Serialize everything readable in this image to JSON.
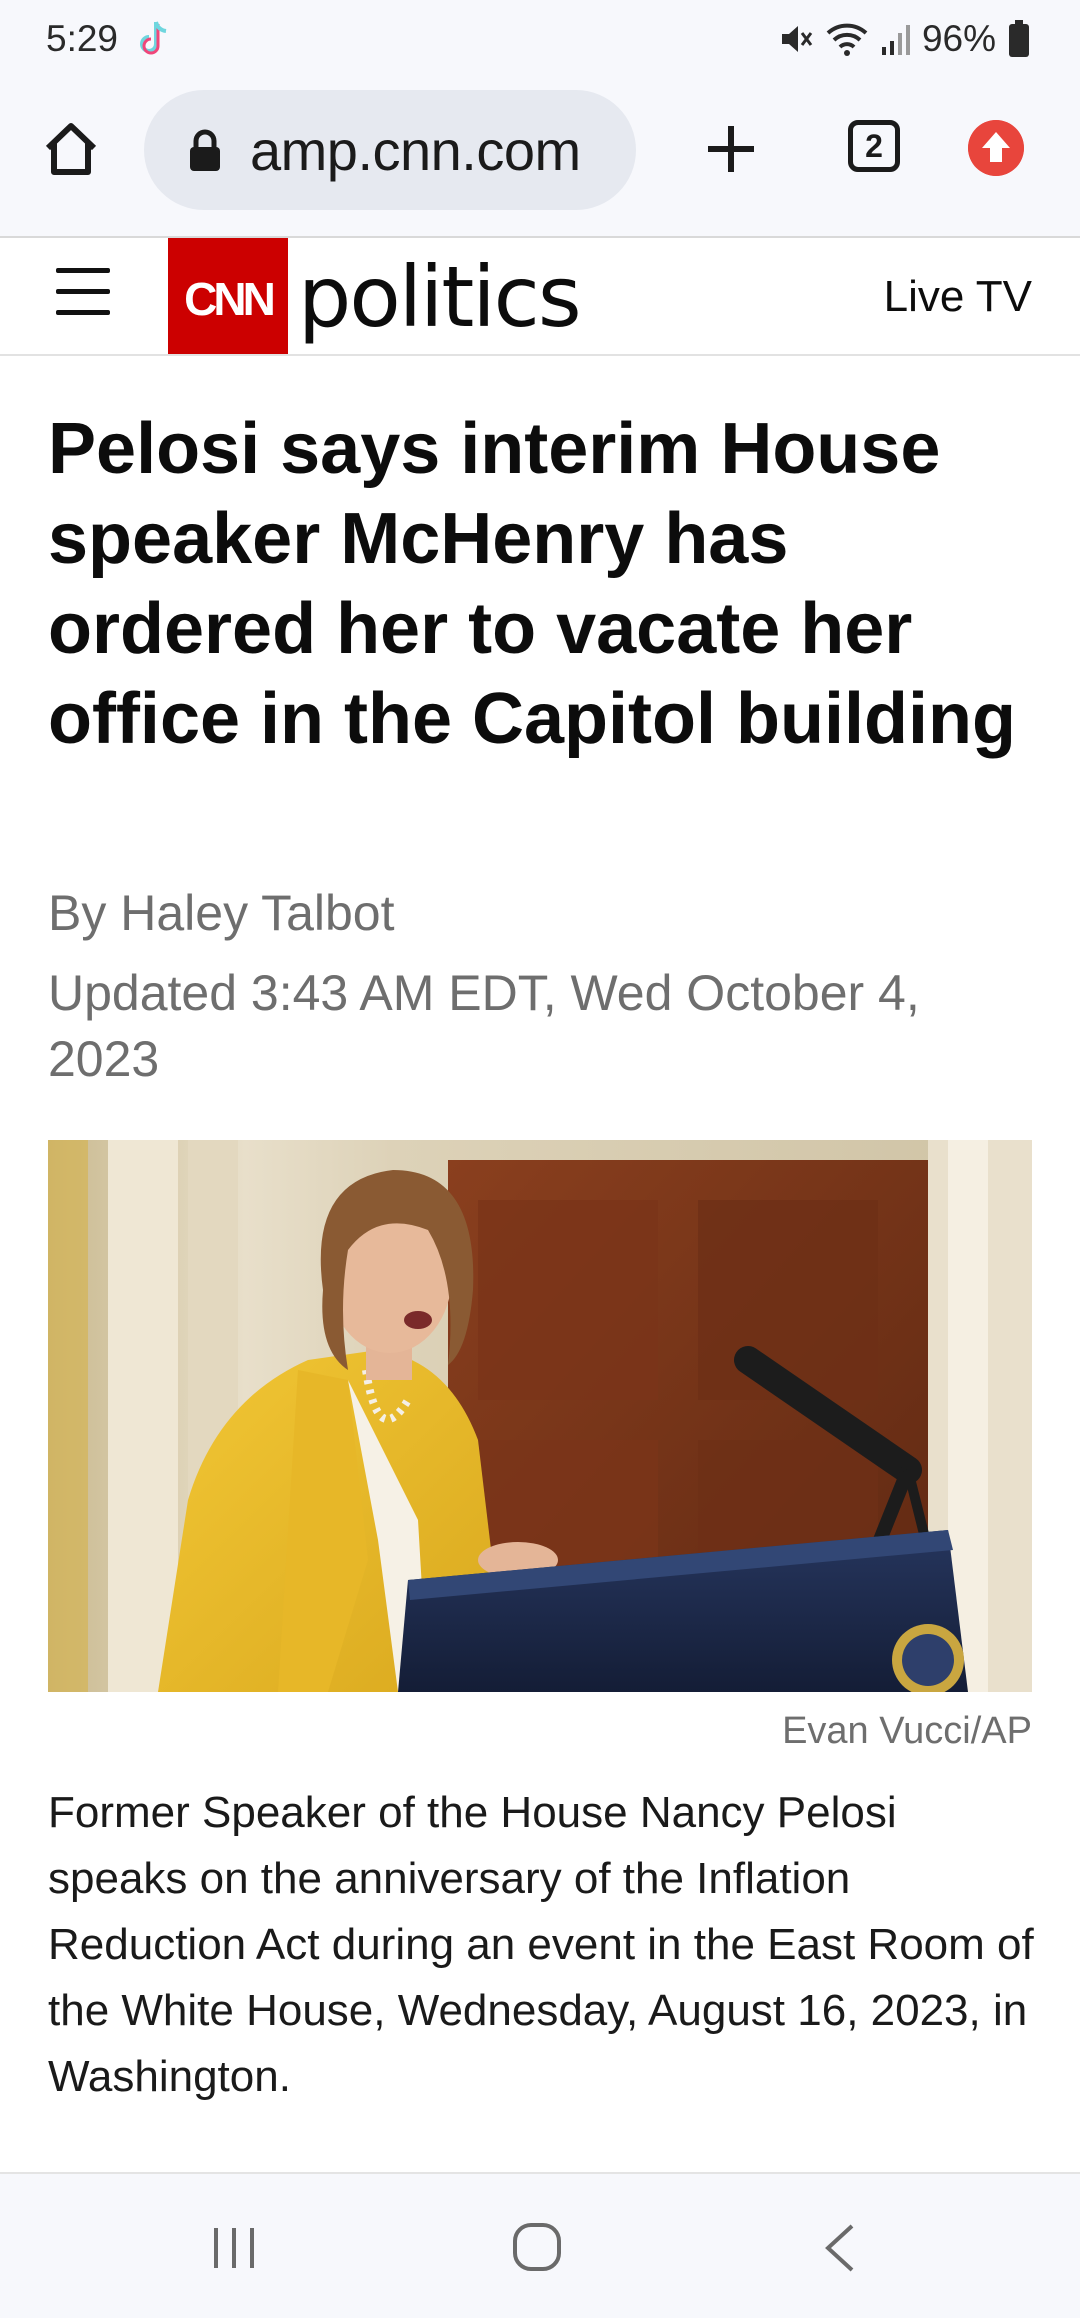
{
  "status_bar": {
    "time": "5:29",
    "battery": "96%",
    "icons": [
      "tiktok-icon",
      "mute-icon",
      "wifi-icon",
      "signal-icon",
      "battery-icon"
    ]
  },
  "browser": {
    "url": "amp.cnn.com",
    "tab_count": "2",
    "icons": [
      "home-icon",
      "lock-icon",
      "plus-icon",
      "tabs-icon",
      "update-icon"
    ]
  },
  "site_header": {
    "logo_text": "CNN",
    "section": "politics",
    "live_tv": "Live TV",
    "brand_color": "#cc0000"
  },
  "article": {
    "headline": "Pelosi says interim House speaker McHenry has ordered her to vacate her office in the Capitol building",
    "byline_prefix": "By ",
    "author": "Haley Talbot",
    "updated": "Updated 3:43 AM EDT, Wed October 4, 2023",
    "photo_credit": "Evan Vucci/AP",
    "caption": "Former Speaker of the House Nancy Pelosi speaks on the anniversary of the Inflation Reduction Act during an event in the East Room of the White House, Wednesday, August 16, 2023, in Washington."
  },
  "nav_bar": {
    "icons": [
      "recents-icon",
      "home-circle-icon",
      "back-icon"
    ]
  }
}
